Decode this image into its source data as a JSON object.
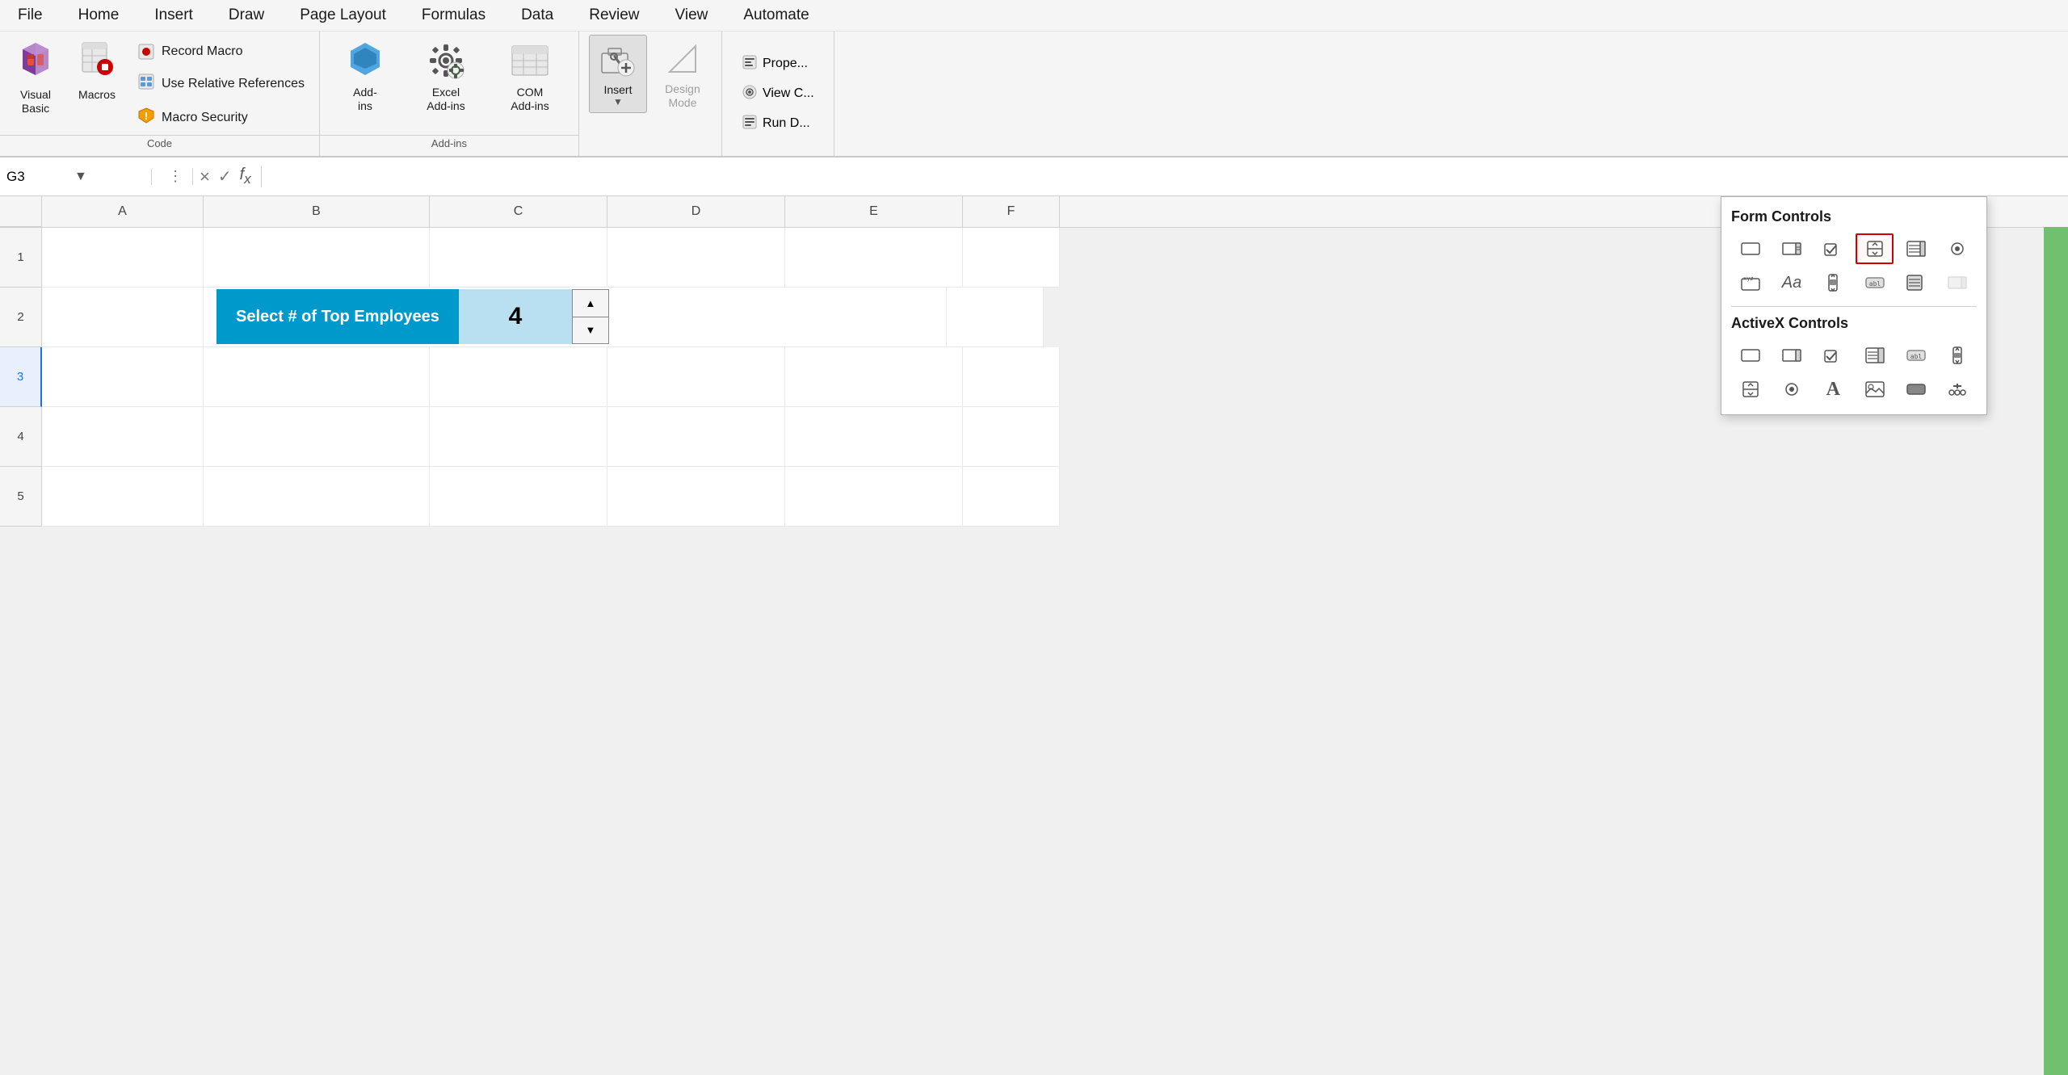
{
  "menu": {
    "items": [
      "File",
      "Home",
      "Insert",
      "Draw",
      "Page Layout",
      "Formulas",
      "Data",
      "Review",
      "View",
      "Automate"
    ]
  },
  "ribbon": {
    "code_group": {
      "label": "Code",
      "visual_basic": {
        "label": "Visual\nBasic"
      },
      "macros": {
        "label": "Macros"
      },
      "record_macro": {
        "label": "Record Macro"
      },
      "use_relative": {
        "label": "Use Relative References"
      },
      "macro_security": {
        "label": "Macro Security"
      }
    },
    "addins_group": {
      "label": "Add-ins",
      "add_ins": {
        "label": "Add-\nins"
      },
      "excel_add_ins": {
        "label": "Excel\nAdd-ins"
      },
      "com_add_ins": {
        "label": "COM\nAdd-ins"
      }
    },
    "controls_group": {
      "insert_btn": {
        "label": "Insert"
      },
      "design_mode": {
        "label": "Design\nMode"
      },
      "properties": {
        "label": "Prope..."
      },
      "view_code": {
        "label": "View C..."
      },
      "run_dialog": {
        "label": "Run D..."
      }
    }
  },
  "formula_bar": {
    "cell_ref": "G3",
    "cancel_label": "×",
    "confirm_label": "✓",
    "fx_label": "fx"
  },
  "grid": {
    "col_headers": [
      "",
      "A",
      "B",
      "C",
      "D",
      "E",
      "F"
    ],
    "rows": [
      {
        "num": "1",
        "cells": [
          "",
          "",
          "",
          "",
          "",
          "",
          ""
        ]
      },
      {
        "num": "2",
        "cells": [
          "",
          "",
          "",
          "",
          "",
          "",
          ""
        ]
      },
      {
        "num": "3",
        "cells": [
          "",
          "",
          "",
          "",
          "",
          "",
          ""
        ]
      },
      {
        "num": "4",
        "cells": [
          "",
          "",
          "",
          "",
          "",
          "",
          ""
        ]
      },
      {
        "num": "5",
        "cells": [
          "",
          "",
          "",
          "",
          "",
          "",
          ""
        ]
      }
    ],
    "spinner": {
      "label": "Select # of Top Employees",
      "value": "4"
    }
  },
  "form_controls_panel": {
    "title": "Form Controls",
    "controls": [
      {
        "name": "label-control",
        "icon": "⬜",
        "tooltip": "Label"
      },
      {
        "name": "combo-box-control",
        "icon": "▤",
        "tooltip": "Combo Box"
      },
      {
        "name": "checkbox-control",
        "icon": "☑",
        "tooltip": "Check Box"
      },
      {
        "name": "spinner-control",
        "icon": "⬆⬇",
        "tooltip": "Spin Button",
        "highlighted": true
      },
      {
        "name": "list-box-control",
        "icon": "≡⬜",
        "tooltip": "List Box"
      },
      {
        "name": "radio-control",
        "icon": "⊙",
        "tooltip": "Option Button"
      },
      {
        "name": "group-box-control",
        "icon": "xyz\n⬜",
        "tooltip": "Group Box"
      },
      {
        "name": "label2-control",
        "icon": "Aa",
        "tooltip": "Label"
      },
      {
        "name": "scrollbar-control",
        "icon": "↕⬜",
        "tooltip": "Scroll Bar"
      },
      {
        "name": "button-control",
        "icon": "abl",
        "tooltip": "Button"
      },
      {
        "name": "list2-control",
        "icon": "⬛≡",
        "tooltip": "List"
      },
      {
        "name": "combo2-control",
        "icon": "▤▤",
        "tooltip": "Combo"
      }
    ],
    "activex_title": "ActiveX Controls",
    "activex_controls": [
      {
        "name": "ax-label",
        "icon": "⬜",
        "tooltip": "Label"
      },
      {
        "name": "ax-combo",
        "icon": "▤",
        "tooltip": "Combo Box"
      },
      {
        "name": "ax-checkbox",
        "icon": "☑",
        "tooltip": "Check Box"
      },
      {
        "name": "ax-listbox",
        "icon": "≡⬜",
        "tooltip": "List Box"
      },
      {
        "name": "ax-text",
        "icon": "abl",
        "tooltip": "Text Box"
      },
      {
        "name": "ax-scroll",
        "icon": "↕",
        "tooltip": "Scroll Bar"
      },
      {
        "name": "ax-spinner",
        "icon": "⬆⬇",
        "tooltip": "Spin Button"
      },
      {
        "name": "ax-radio",
        "icon": "⊙",
        "tooltip": "Option Button"
      },
      {
        "name": "ax-bigA",
        "icon": "A",
        "tooltip": "Label"
      },
      {
        "name": "ax-image",
        "icon": "🖼",
        "tooltip": "Image"
      },
      {
        "name": "ax-toggle",
        "icon": "⬛",
        "tooltip": "Toggle Button"
      },
      {
        "name": "ax-more",
        "icon": "🔧",
        "tooltip": "More Controls"
      }
    ]
  },
  "colors": {
    "accent_blue": "#0099cc",
    "light_blue": "#cce6f7",
    "highlight_red": "#cc0000",
    "ribbon_bg": "#f5f5f5",
    "active_blue": "#1a73e8"
  }
}
